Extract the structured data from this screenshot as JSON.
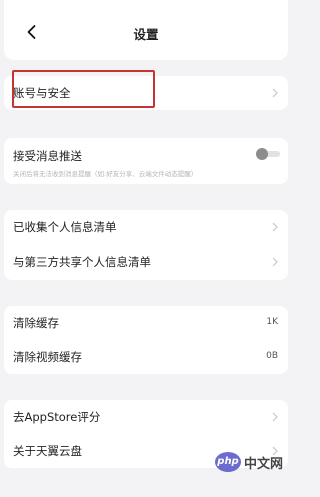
{
  "header": {
    "title": "设置"
  },
  "account": {
    "label": "账号与安全"
  },
  "push": {
    "label": "接受消息推送",
    "description": "关闭后将无法收到消息提醒（如:好友分享、云端文件动态提醒）",
    "enabled": false
  },
  "privacy": {
    "items": [
      {
        "label": "已收集个人信息清单"
      },
      {
        "label": "与第三方共享个人信息清单"
      }
    ]
  },
  "cache": {
    "items": [
      {
        "label": "清除缓存",
        "value": "1K"
      },
      {
        "label": "清除视频缓存",
        "value": "0B"
      }
    ]
  },
  "about": {
    "items": [
      {
        "label": "去AppStore评分"
      },
      {
        "label": "关于天翼云盘"
      }
    ]
  },
  "watermark": {
    "logo_text": "php",
    "text": "中文网"
  },
  "colors": {
    "highlight": "#c73232",
    "background": "#f3f3f5",
    "watermark": "#6b6bd0"
  }
}
